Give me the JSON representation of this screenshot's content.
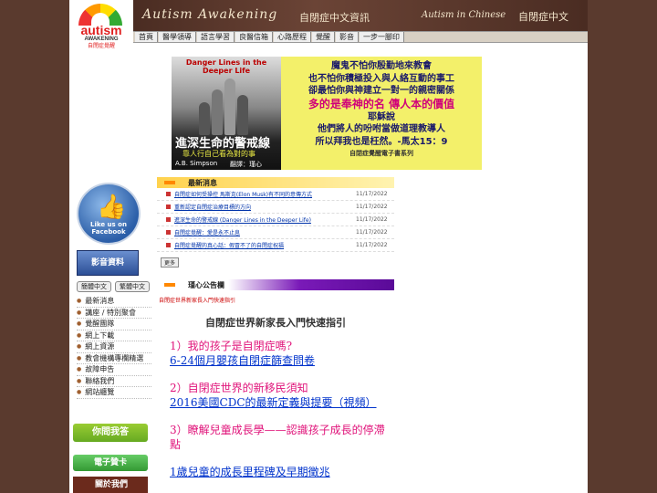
{
  "logo": {
    "word": "autism",
    "sub": "AWAKENING",
    "zh": "自閉症覺醒"
  },
  "banner": {
    "title_en": "Autism Awakening",
    "title_zh": "自閉症中文資訊",
    "right_en": "Autism in Chinese",
    "right_zh": "自閉症中文"
  },
  "nav": [
    "首頁",
    "醫學領導",
    "語言學習",
    "良醫信箱",
    "心路歷程",
    "覺醒",
    "影音",
    "一步一腳印"
  ],
  "hero": {
    "book_title": "Danger Lines in the Deeper Life",
    "book_zh": "進深生命的警戒線",
    "book_sub": "靠人行自己看為對的事",
    "author": "A.B. Simpson",
    "translator": "翻譯：瑾心",
    "quote": [
      "魔鬼不怕你殷勤地來教會",
      "也不怕你積極投入與人絡互動的事工",
      "卻最怕你與神建立一對一的親密關係"
    ],
    "quote_hl": "多的是奉神的名 傳人本的價值",
    "quote2": [
      "耶穌說",
      "他們將人的吩咐當做道理教導人",
      "所以拜我也是枉然。-馬太15：9"
    ],
    "series": "自閉症覺醒電子書系列"
  },
  "sidebar": {
    "fb": "Like us on Facebook",
    "media": "影音資料",
    "lang": [
      "簡體中文",
      "繁體中文"
    ],
    "menu": [
      "最新消息",
      "講座 / 特別聚會",
      "覺醒團隊",
      "網上下載",
      "網上資源",
      "教會機構專欄精選",
      "故障申告",
      "聯絡我們",
      "網站纏覽"
    ],
    "ask": "你問我答",
    "ebook": "電子贊卡",
    "about": "關於我們"
  },
  "news": {
    "header": "最新消息",
    "items": [
      {
        "title": "自閉症如何受操控 馬斯克(Elon Musk)有不同的意傳方式",
        "date": "11/17/2022"
      },
      {
        "title": "重新認定自閉症治療目標的方向",
        "date": "11/17/2022"
      },
      {
        "title": "進深生命的警戒線 (Danger Lines in the Deeper Life)",
        "date": "11/17/2022"
      },
      {
        "title": "自閉症覺醒：愛是永不止息",
        "date": "11/17/2022"
      },
      {
        "title": "自閉症覺醒的真心話：假冒不了的自閉症祝福",
        "date": "11/17/2022"
      }
    ],
    "more": "更多"
  },
  "notice": {
    "header": "瑾心公告欄",
    "crumb": "自閉症世界新家長入門快速指引",
    "title": "自閉症世界新家長入門快速指引",
    "q1": "1）我的孩子是自閉症嗎?",
    "l1": "6-24個月嬰孩自閉症篩查問卷",
    "q2": "2）自閉症世界的新移民須知",
    "l2": "2016美國CDC的最新定義與提要（視頻）",
    "q3": "3）瞭解兒童成長學——認識孩子成長的停滯點",
    "l3": "1歲兒童的成長里程碑及早期徵兆"
  }
}
